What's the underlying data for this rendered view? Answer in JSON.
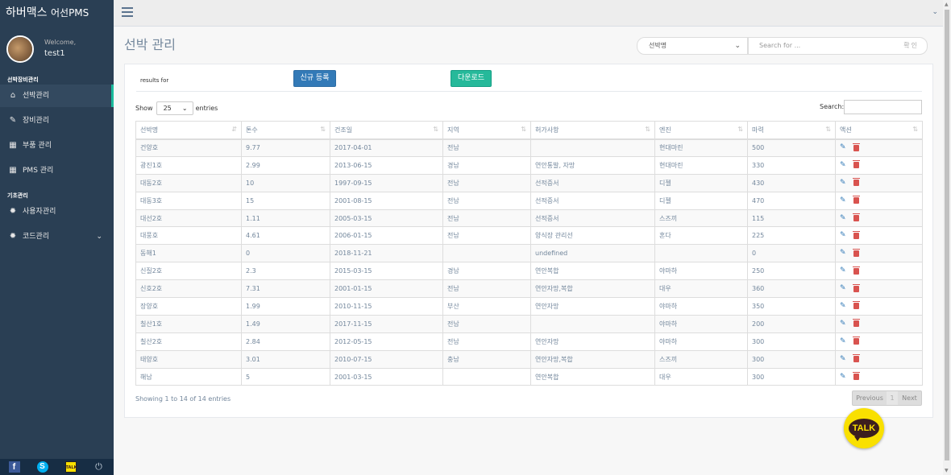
{
  "brand": {
    "name": "하버맥스",
    "sub": "어선PMS"
  },
  "profile": {
    "welcome": "Welcome,",
    "username": "test1"
  },
  "sidebar": {
    "section1": "선박장비관리",
    "items1": [
      {
        "label": "선박관리",
        "icon": "home-icon",
        "active": true
      },
      {
        "label": "장비관리",
        "icon": "edit-icon"
      },
      {
        "label": "부품 관리",
        "icon": "table-icon"
      },
      {
        "label": "PMS 관리",
        "icon": "table-icon"
      }
    ],
    "section2": "기초관리",
    "items2": [
      {
        "label": "사용자관리",
        "icon": "bug-icon"
      },
      {
        "label": "코드관리",
        "icon": "bug-icon"
      }
    ]
  },
  "page": {
    "title": "선박 관리",
    "ship_select": "선박명",
    "search_placeholder": "Search for ...",
    "search_go": "확인"
  },
  "panel": {
    "results_for": "results for",
    "new_button": "신규 등록",
    "download_button": "다운로드",
    "show_label": "Show",
    "entries_label": "entries",
    "page_length": "25",
    "search_label": "Search:",
    "info": "Showing 1 to 14 of 14 entries",
    "prev": "Previous",
    "page": "1",
    "next": "Next"
  },
  "table": {
    "headers": [
      "선박명",
      "톤수",
      "건조일",
      "지역",
      "허가사항",
      "엔진",
      "마력",
      "액션"
    ],
    "rows": [
      [
        "건양호",
        "9.77",
        "2017-04-01",
        "전남",
        "",
        "현대마린",
        "500"
      ],
      [
        "광진1호",
        "2.99",
        "2013-06-15",
        "경남",
        "연안통발, 자망",
        "현대마린",
        "330"
      ],
      [
        "대동2호",
        "10",
        "1997-09-15",
        "전남",
        "선적증서",
        "디젤",
        "430"
      ],
      [
        "대동3호",
        "15",
        "2001-08-15",
        "전남",
        "선적증서",
        "디젤",
        "470"
      ],
      [
        "대선2호",
        "1.11",
        "2005-03-15",
        "전남",
        "선적증서",
        "스즈끼",
        "115"
      ],
      [
        "대풍호",
        "4.61",
        "2006-01-15",
        "전남",
        "양식장 관리선",
        "혼다",
        "225"
      ],
      [
        "동해1",
        "0",
        "2018-11-21",
        "",
        "undefined",
        "",
        "0"
      ],
      [
        "신질2호",
        "2.3",
        "2015-03-15",
        "경남",
        "연안복합",
        "야마하",
        "250"
      ],
      [
        "신호2호",
        "7.31",
        "2001-01-15",
        "전남",
        "연안자망,복합",
        "대우",
        "360"
      ],
      [
        "장양호",
        "1.99",
        "2010-11-15",
        "부산",
        "연안자망",
        "야마하",
        "350"
      ],
      [
        "칠산1호",
        "1.49",
        "2017-11-15",
        "전남",
        "",
        "야마하",
        "200"
      ],
      [
        "칠산2호",
        "2.84",
        "2012-05-15",
        "전남",
        "연안자망",
        "야마하",
        "300"
      ],
      [
        "태양호",
        "3.01",
        "2010-07-15",
        "충남",
        "연안자망,복합",
        "스즈끼",
        "300"
      ],
      [
        "해남",
        "5",
        "2001-03-15",
        "",
        "연안복합",
        "대우",
        "300"
      ]
    ]
  },
  "talk": {
    "label": "TALK"
  },
  "footer": {
    "skype": "S",
    "facebook": "f",
    "kakao": "TALK"
  },
  "colors": {
    "sidebar": "#2a3f54",
    "accent": "#1abb9c",
    "primary": "#337ab7",
    "success": "#26b99a",
    "danger": "#d9534f"
  }
}
